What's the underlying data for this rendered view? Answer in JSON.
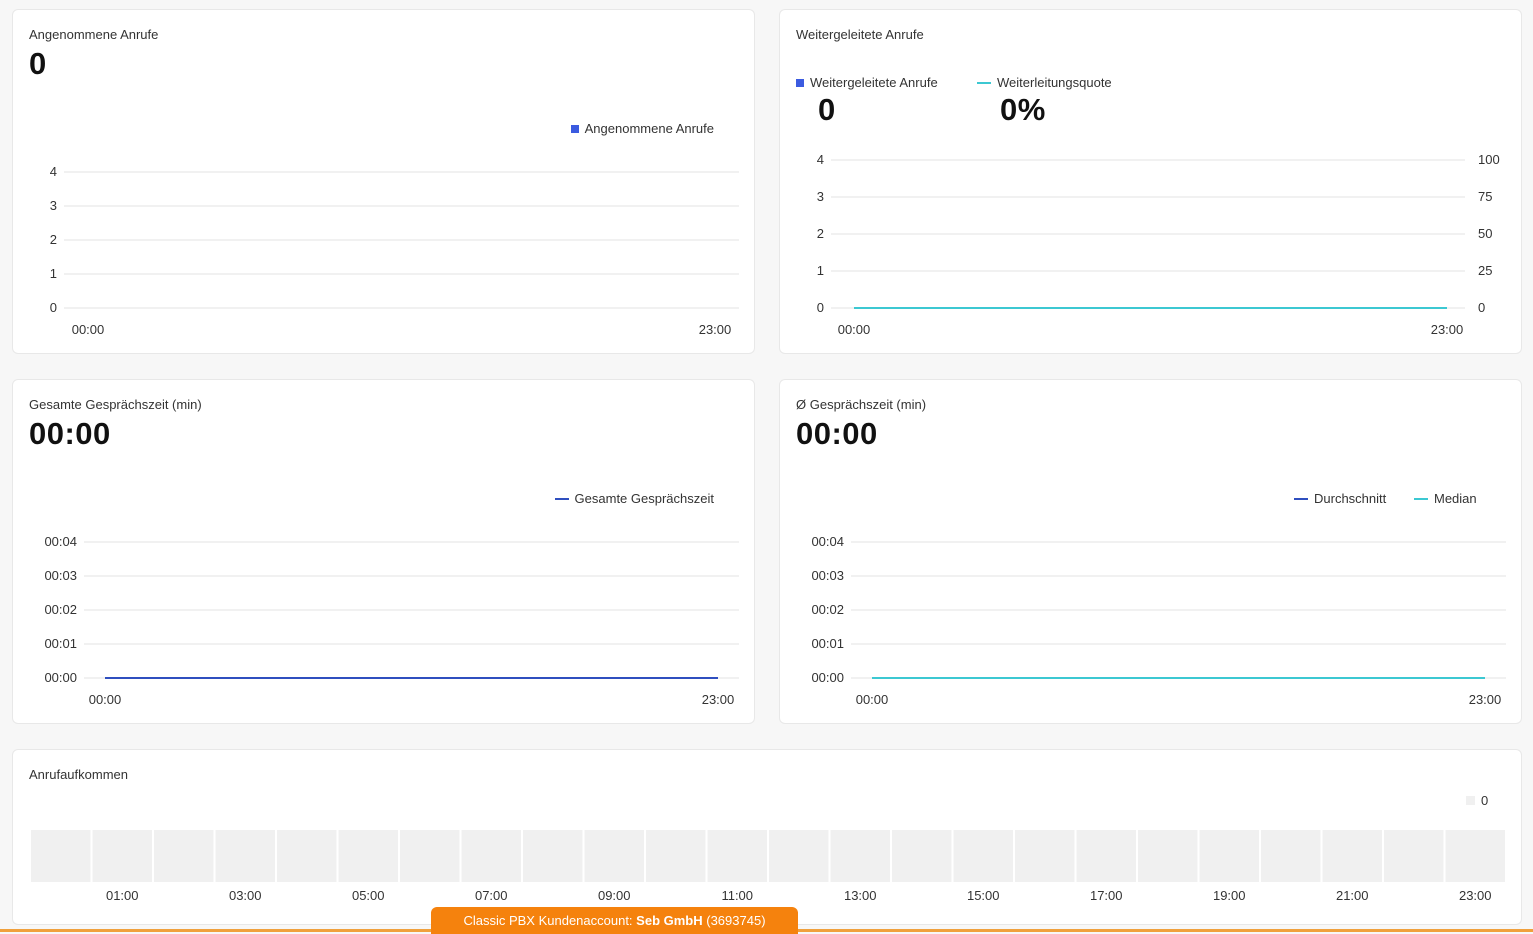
{
  "colors": {
    "blue": "#3b5be0",
    "cyan": "#3cc8d2",
    "grid": "#e3e3e3",
    "heat": "#f0f0f0",
    "footer": "#f5820d"
  },
  "panels": {
    "answered": {
      "title": "Angenommene Anrufe",
      "kpi": "0",
      "legend": "Angenommene Anrufe"
    },
    "forwarded": {
      "title": "Weitergeleitete Anrufe",
      "legend_calls": "Weitergeleitete Anrufe",
      "legend_rate": "Weiterleitungsquote",
      "kpi_calls": "0",
      "kpi_rate": "0%"
    },
    "total_time": {
      "title": "Gesamte Gesprächszeit (min)",
      "kpi": "00:00",
      "legend": "Gesamte Gesprächszeit"
    },
    "avg_time": {
      "title": "Ø Gesprächszeit (min)",
      "kpi": "00:00",
      "legend_avg": "Durchschnitt",
      "legend_median": "Median"
    },
    "volume": {
      "title": "Anrufaufkommen",
      "legend_value": "0"
    }
  },
  "chart_data": [
    {
      "id": "answered",
      "type": "bar",
      "x_tick_labels": [
        "00:00",
        "23:00"
      ],
      "y_ticks": [
        "0",
        "1",
        "2",
        "3",
        "4"
      ],
      "series": [
        {
          "name": "Angenommene Anrufe",
          "values": []
        }
      ],
      "ylim": [
        0,
        4
      ]
    },
    {
      "id": "forwarded",
      "type": "line",
      "x_tick_labels": [
        "00:00",
        "23:00"
      ],
      "y_ticks": [
        "0",
        "1",
        "2",
        "3",
        "4"
      ],
      "y2_ticks": [
        "0",
        "25",
        "50",
        "75",
        "100"
      ],
      "series": [
        {
          "name": "Weitergeleitete Anrufe",
          "values": []
        },
        {
          "name": "Weiterleitungsquote",
          "values": [
            0,
            0
          ]
        }
      ],
      "ylim": [
        0,
        4
      ],
      "y2lim": [
        0,
        100
      ]
    },
    {
      "id": "total_time",
      "type": "line",
      "x_tick_labels": [
        "00:00",
        "23:00"
      ],
      "y_ticks": [
        "00:00",
        "00:01",
        "00:02",
        "00:03",
        "00:04"
      ],
      "series": [
        {
          "name": "Gesamte Gesprächszeit",
          "values": [
            0,
            0
          ]
        }
      ]
    },
    {
      "id": "avg_time",
      "type": "line",
      "x_tick_labels": [
        "00:00",
        "23:00"
      ],
      "y_ticks": [
        "00:00",
        "00:01",
        "00:02",
        "00:03",
        "00:04"
      ],
      "series": [
        {
          "name": "Durchschnitt",
          "values": []
        },
        {
          "name": "Median",
          "values": [
            0,
            0
          ]
        }
      ]
    },
    {
      "id": "volume",
      "type": "heatmap",
      "x_tick_labels": [
        "01:00",
        "03:00",
        "05:00",
        "07:00",
        "09:00",
        "11:00",
        "13:00",
        "15:00",
        "17:00",
        "19:00",
        "21:00",
        "23:00"
      ],
      "hours": 24,
      "values": [
        0,
        0,
        0,
        0,
        0,
        0,
        0,
        0,
        0,
        0,
        0,
        0,
        0,
        0,
        0,
        0,
        0,
        0,
        0,
        0,
        0,
        0,
        0,
        0
      ],
      "legend": [
        "0"
      ]
    }
  ],
  "footer": {
    "prefix": "Classic PBX Kundenaccount: ",
    "company": "Seb GmbH",
    "account": " (3693745)"
  }
}
